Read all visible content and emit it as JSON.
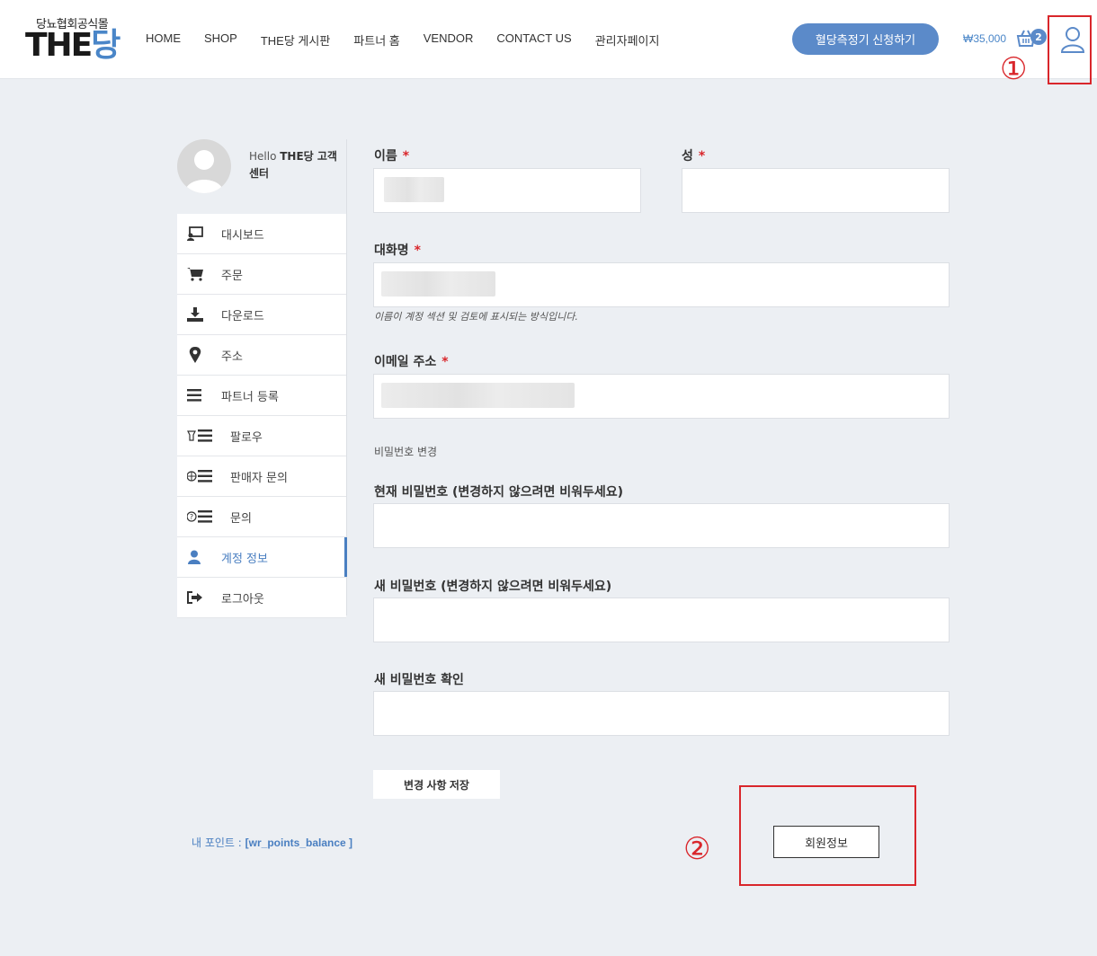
{
  "header": {
    "logo_sub": "당뇨협회공식몰",
    "logo_main": "THE",
    "logo_accent": "당",
    "nav": [
      "HOME",
      "SHOP",
      "THE당 게시판",
      "파트너 홈",
      "VENDOR",
      "CONTACT US",
      "관리자페이지"
    ],
    "cta": "혈당측정기 신청하기",
    "cart_total": "₩35,000",
    "cart_count": "2",
    "marker_1": "①"
  },
  "sidebar": {
    "hello_prefix": "Hello ",
    "user_name": "THE당 고객센터",
    "items": [
      {
        "label": "대시보드",
        "icon": "dashboard-icon"
      },
      {
        "label": "주문",
        "icon": "cart-icon"
      },
      {
        "label": "다운로드",
        "icon": "download-icon"
      },
      {
        "label": "주소",
        "icon": "location-pin-icon"
      },
      {
        "label": "파트너 등록",
        "icon": "list-icon"
      },
      {
        "label": "팔로우",
        "icon": "follow-list-icon"
      },
      {
        "label": "판매자 문의",
        "icon": "vendor-inquiry-icon"
      },
      {
        "label": "문의",
        "icon": "question-list-icon"
      },
      {
        "label": "계정 정보",
        "icon": "user-icon",
        "active": true
      },
      {
        "label": "로그아웃",
        "icon": "logout-icon"
      }
    ],
    "points_label": "내 포인트 : ",
    "points_value": "[wr_points_balance ]"
  },
  "form": {
    "first_name_label": "이름",
    "last_name_label": "성",
    "display_name_label": "대화명",
    "display_name_hint": "이름이 계정 섹션 및 검토에 표시되는 방식입니다.",
    "email_label": "이메일 주소",
    "required_mark": "*",
    "password_section": "비밀번호 변경",
    "current_password_label": "현재 비밀번호 (변경하지 않으려면 비워두세요)",
    "new_password_label": "새 비밀번호 (변경하지 않으려면 비워두세요)",
    "confirm_password_label": "새 비밀번호 확인",
    "save_button": "변경 사항 저장",
    "member_button": "회원정보",
    "marker_2": "②"
  },
  "colors": {
    "accent": "#5b8ac9",
    "annotation": "#d9262b",
    "background": "#eceff3"
  }
}
